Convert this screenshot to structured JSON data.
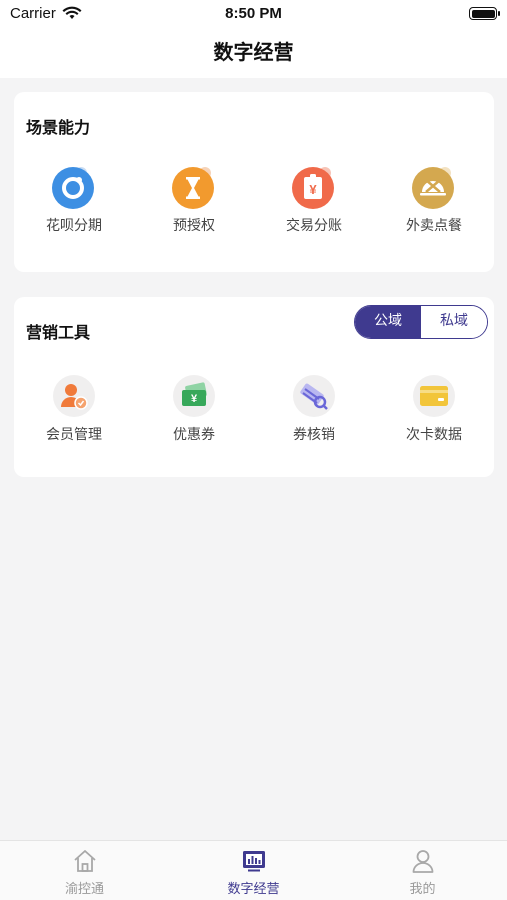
{
  "status_bar": {
    "carrier": "Carrier",
    "time": "8:50 PM"
  },
  "header": {
    "title": "数字经营"
  },
  "scene_section": {
    "title": "场景能力",
    "items": [
      {
        "label": "花呗分期",
        "icon": "huabei-icon",
        "color": "#3d8fe3"
      },
      {
        "label": "预授权",
        "icon": "hourglass-icon",
        "color": "#f29a2e"
      },
      {
        "label": "交易分账",
        "icon": "split-bill-icon",
        "color": "#f06a4a"
      },
      {
        "label": "外卖点餐",
        "icon": "food-delivery-icon",
        "color": "#d4a84f"
      }
    ]
  },
  "marketing_section": {
    "title": "营销工具",
    "toggle": {
      "options": [
        "公域",
        "私域"
      ],
      "selected": "公域"
    },
    "items": [
      {
        "label": "会员管理",
        "icon": "member-icon",
        "color": "#f07a3a"
      },
      {
        "label": "优惠券",
        "icon": "coupon-icon",
        "color": "#37a85a"
      },
      {
        "label": "券核销",
        "icon": "coupon-verify-icon",
        "color": "#6a67d8"
      },
      {
        "label": "次卡数据",
        "icon": "card-data-icon",
        "color": "#f2c53a"
      }
    ]
  },
  "tab_bar": {
    "tabs": [
      {
        "label": "渝控通",
        "icon": "home-icon",
        "active": false
      },
      {
        "label": "数字经营",
        "icon": "dashboard-icon",
        "active": true
      },
      {
        "label": "我的",
        "icon": "profile-icon",
        "active": false
      }
    ]
  },
  "colors": {
    "accent": "#3f3a8f",
    "background": "#f4f4f5"
  }
}
